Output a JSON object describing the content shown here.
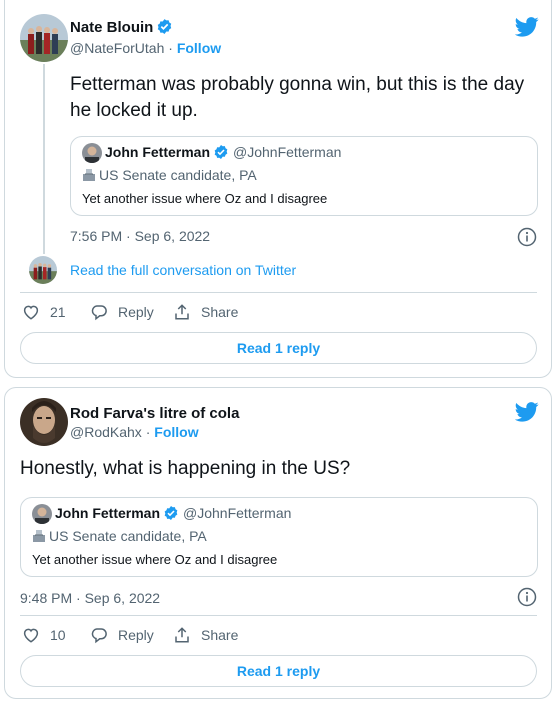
{
  "colors": {
    "accent": "#1d9bf0",
    "text": "#0f1419",
    "muted": "#536471",
    "border": "#cfd9de"
  },
  "tweets": [
    {
      "author": {
        "name": "Nate Blouin",
        "handle": "@NateForUtah",
        "verified": true
      },
      "follow_label": "Follow",
      "text": "Fetterman was probably gonna win, but this is the day he locked it up.",
      "quote": {
        "name": "John Fetterman",
        "handle": "@JohnFetterman",
        "label": "US Senate candidate, PA",
        "text": "Yet another issue where Oz and I disagree"
      },
      "timestamp": "7:56 PM · Sep 6, 2022",
      "read_conversation": "Read the full conversation on Twitter",
      "likes": "21",
      "reply_label": "Reply",
      "share_label": "Share",
      "read_replies": "Read 1 reply"
    },
    {
      "author": {
        "name": "Rod Farva's litre of cola",
        "handle": "@RodKahx",
        "verified": false
      },
      "follow_label": "Follow",
      "text": "Honestly, what is happening in the US?",
      "quote": {
        "name": "John Fetterman",
        "handle": "@JohnFetterman",
        "label": "US Senate candidate, PA",
        "text": "Yet another issue where Oz and I disagree"
      },
      "timestamp": "9:48 PM · Sep 6, 2022",
      "likes": "10",
      "reply_label": "Reply",
      "share_label": "Share",
      "read_replies": "Read 1 reply"
    }
  ]
}
